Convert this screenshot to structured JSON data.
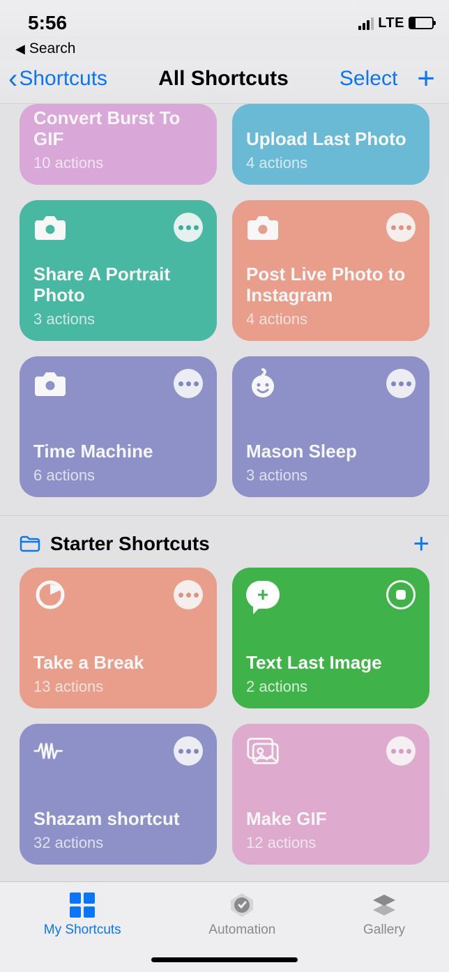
{
  "status": {
    "time": "5:56",
    "carrier": "LTE"
  },
  "breadcrumb": {
    "label": "Search"
  },
  "nav": {
    "back": "Shortcuts",
    "title": "All Shortcuts",
    "select": "Select"
  },
  "section1_cards": [
    {
      "title": "Convert Burst To GIF",
      "sub": "10 actions"
    },
    {
      "title": "Upload Last Photo",
      "sub": "4 actions"
    },
    {
      "title": "Share A Portrait Photo",
      "sub": "3 actions"
    },
    {
      "title": "Post Live Photo to Instagram",
      "sub": "4 actions"
    },
    {
      "title": "Time Machine",
      "sub": "6 actions"
    },
    {
      "title": "Mason Sleep",
      "sub": "3 actions"
    }
  ],
  "section2": {
    "title": "Starter Shortcuts"
  },
  "section2_cards": [
    {
      "title": "Take a Break",
      "sub": "13 actions"
    },
    {
      "title": "Text Last Image",
      "sub": "2 actions"
    },
    {
      "title": "Shazam shortcut",
      "sub": "32 actions"
    },
    {
      "title": "Make GIF",
      "sub": "12 actions"
    }
  ],
  "tabs": {
    "my": "My Shortcuts",
    "auto": "Automation",
    "gallery": "Gallery"
  }
}
